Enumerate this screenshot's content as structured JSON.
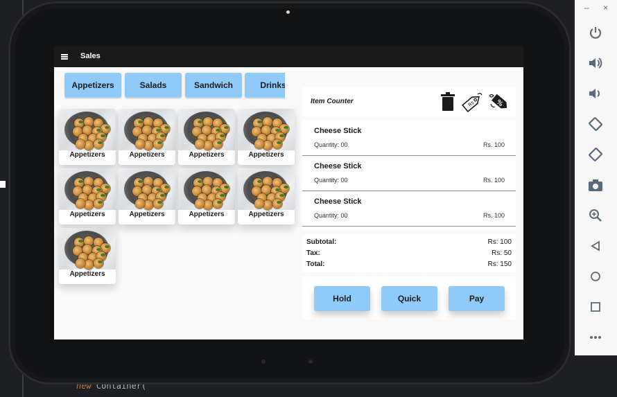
{
  "ide": {
    "code_keyword": "new",
    "code_rest": " Container("
  },
  "emulator": {
    "window_controls": [
      "–",
      "×"
    ],
    "icons": [
      "power-icon",
      "volume-up-icon",
      "volume-down-icon",
      "rotate-left-icon",
      "rotate-right-icon",
      "camera-icon",
      "zoom-icon",
      "back-icon",
      "home-icon",
      "overview-icon",
      "more-icon"
    ]
  },
  "appbar": {
    "title": "Sales",
    "menu_icon": "menu-icon"
  },
  "categories": [
    "Appetizers",
    "Salads",
    "Sandwich",
    "Drinks"
  ],
  "products": [
    {
      "label": "Appetizers"
    },
    {
      "label": "Appetizers"
    },
    {
      "label": "Appetizers"
    },
    {
      "label": "Appetizers"
    },
    {
      "label": "Appetizers"
    },
    {
      "label": "Appetizers"
    },
    {
      "label": "Appetizers"
    },
    {
      "label": "Appetizers"
    },
    {
      "label": "Appetizers"
    }
  ],
  "counter": {
    "title": "Item Counter",
    "icons": [
      "trash-icon",
      "price-tag-icon",
      "discount-tag-icon"
    ],
    "tag_text": "Rs",
    "discount_text": "%"
  },
  "order_items": [
    {
      "name": "Cheese Stick",
      "quantity": "Quantity: 00",
      "price": "Rs. 100"
    },
    {
      "name": "Cheese Stick",
      "quantity": "Quantity: 00",
      "price": "Rs. 100"
    },
    {
      "name": "Cheese Stick",
      "quantity": "Quantity: 00",
      "price": "Rs. 100"
    }
  ],
  "summary": {
    "subtotal_label": "Subtotal:",
    "subtotal_value": "Rs: 100",
    "tax_label": "Tax:",
    "tax_value": "Rs: 50",
    "total_label": "Total:",
    "total_value": "Rs: 150"
  },
  "actions": {
    "hold": "Hold",
    "quick": "Quick",
    "pay": "Pay"
  },
  "colors": {
    "accent": "#90caf9",
    "appbar": "#1a1a1a",
    "screen_bg": "#fafafa"
  }
}
